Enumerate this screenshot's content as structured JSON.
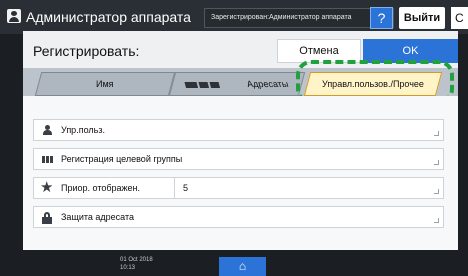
{
  "header": {
    "title": "Администратор аппарата",
    "status_text": "Зарегистрирован:Администратор аппарата",
    "help_label": "?",
    "logout_label": "Выйти",
    "extra_label": "С"
  },
  "dialog": {
    "title": "Регистрировать:",
    "cancel_label": "Отмена",
    "ok_label": "OK"
  },
  "tabs": [
    {
      "label": "Имя"
    },
    {
      "label": "Адресаты"
    },
    {
      "label": "Управл.пользов./Прочее",
      "active": true
    }
  ],
  "rows": [
    {
      "label": "Упр.польз.",
      "icon": "user-icon"
    },
    {
      "label": "Регистрация целевой группы",
      "icon": "group-icon"
    },
    {
      "label": "Приор. отображен.",
      "value": "5",
      "icon": "star-icon"
    },
    {
      "label": "Защита адресата",
      "icon": "lock-icon"
    }
  ],
  "footer": {
    "datetime": "01 Oct 2018\n10:13",
    "home_icon": "home-icon"
  },
  "colors": {
    "accent": "#2b73d6",
    "highlight": "#21a040",
    "active_tab": "#fff4c7"
  }
}
